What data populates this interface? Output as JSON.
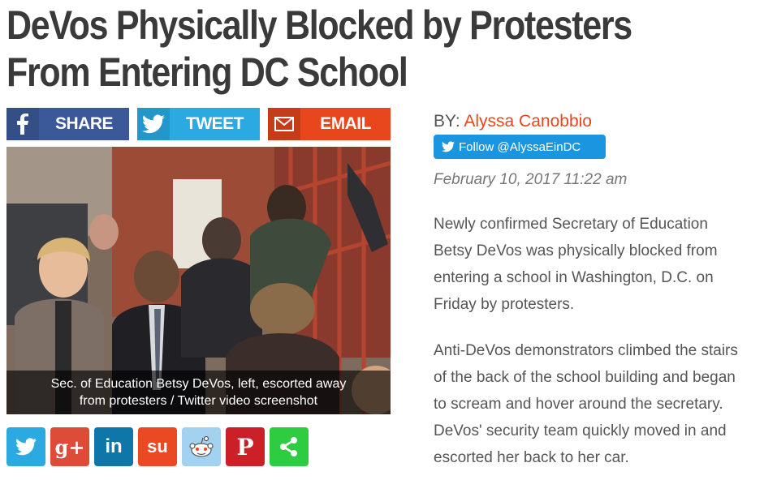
{
  "headline": {
    "line1": "DeVos Physically Blocked by Protesters",
    "line2": "From Entering DC School"
  },
  "share_bar": {
    "facebook": {
      "label": "SHARE",
      "icon": "facebook-icon",
      "color": "#3b5998"
    },
    "twitter": {
      "label": "TWEET",
      "icon": "twitter-icon",
      "color": "#2ba9e1"
    },
    "email": {
      "label": "EMAIL",
      "icon": "mail-icon",
      "color": "#e8471d"
    }
  },
  "photo": {
    "caption_line1": "Sec. of Education Betsy DeVos, left, escorted away",
    "caption_line2": "from protesters / Twitter video screenshot"
  },
  "social_buttons": [
    {
      "name": "twitter",
      "icon": "twitter-icon",
      "glyph": "",
      "color": "#2ba9e1"
    },
    {
      "name": "google-plus",
      "icon": "google-plus-icon",
      "glyph": "g+",
      "color": "#dd4b39"
    },
    {
      "name": "linkedin",
      "icon": "linkedin-icon",
      "glyph": "in",
      "color": "#0e76a8"
    },
    {
      "name": "stumbleupon",
      "icon": "stumbleupon-icon",
      "glyph": "su",
      "color": "#eb4924"
    },
    {
      "name": "reddit",
      "icon": "reddit-icon",
      "glyph": "",
      "color": "#a3d1f0"
    },
    {
      "name": "pinterest",
      "icon": "pinterest-icon",
      "glyph": "P",
      "color": "#cb2027"
    },
    {
      "name": "share",
      "icon": "share-icon",
      "glyph": "",
      "color": "#2ecc40"
    }
  ],
  "byline": {
    "prefix": "BY: ",
    "author": "Alyssa Canobbio",
    "follow_label": "Follow @AlyssaEinDC",
    "date": "February 10, 2017 11:22 am"
  },
  "article": {
    "p1": [
      "Newly confirmed Secretary of Education",
      "Betsy DeVos was physically blocked from",
      "entering a school in Washington, D.C. on",
      "Friday by protesters."
    ],
    "p2": [
      "Anti-DeVos demonstrators climbed the stairs",
      "of the back of the school building and began",
      "to scream and hover around the secretary.",
      "DeVos' security team quickly moved in and",
      "escorted her back to her car."
    ]
  }
}
